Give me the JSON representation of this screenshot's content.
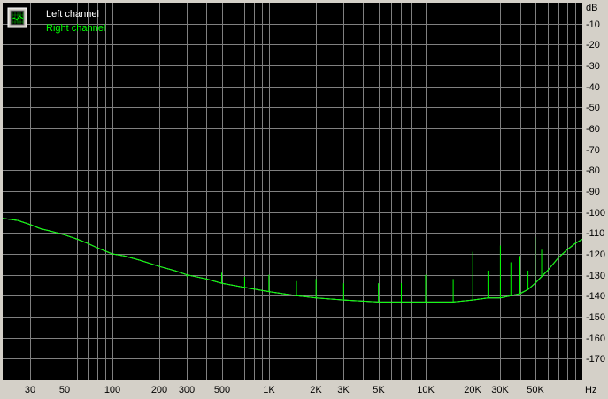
{
  "chart_data": {
    "type": "line",
    "xscale": "log",
    "xlim": [
      20,
      100000
    ],
    "ylim": [
      -180,
      0
    ],
    "grid": true,
    "legend_position": "top-left",
    "x_unit": "Hz",
    "y_unit": "dB",
    "x_tick_labels": [
      "30",
      "50",
      "100",
      "200",
      "300",
      "500",
      "1K",
      "2K",
      "3K",
      "5K",
      "10K",
      "20K",
      "30K",
      "50K"
    ],
    "x_tick_values": [
      30,
      50,
      100,
      200,
      300,
      500,
      1000,
      2000,
      3000,
      5000,
      10000,
      20000,
      30000,
      50000
    ],
    "y_tick_labels": [
      "-10",
      "-20",
      "-30",
      "-40",
      "-50",
      "-60",
      "-70",
      "-80",
      "-90",
      "-100",
      "-110",
      "-120",
      "-130",
      "-140",
      "-150",
      "-160",
      "-170"
    ],
    "y_tick_values": [
      -10,
      -20,
      -30,
      -40,
      -50,
      -60,
      -70,
      -80,
      -90,
      -100,
      -110,
      -120,
      -130,
      -140,
      -150,
      -160,
      -170
    ],
    "colors": {
      "background": "#000000",
      "grid": "#808080",
      "left": "#ffffff",
      "right": "#00ff00",
      "frame": "#d4d0c8"
    },
    "series": [
      {
        "name": "Left channel",
        "x": [
          20,
          25,
          30,
          35,
          40,
          50,
          60,
          70,
          80,
          100,
          120,
          150,
          200,
          250,
          300,
          400,
          500,
          700,
          1000,
          1500,
          2000,
          3000,
          5000,
          7000,
          10000,
          15000,
          20000,
          25000,
          30000,
          35000,
          40000,
          45000,
          50000,
          60000,
          70000,
          80000,
          90000,
          100000
        ],
        "y": [
          -103,
          -104,
          -106,
          -108,
          -109,
          -111,
          -113,
          -115,
          -117,
          -120,
          -121,
          -123,
          -126,
          -128,
          -130,
          -132,
          -134,
          -136,
          -138,
          -140,
          -141,
          -142,
          -143,
          -143,
          -143,
          -143,
          -142,
          -141,
          -141,
          -140,
          -139,
          -137,
          -134,
          -128,
          -122,
          -118,
          -115,
          -113
        ]
      },
      {
        "name": "Right channel",
        "x": [
          20,
          25,
          30,
          35,
          40,
          50,
          60,
          70,
          80,
          100,
          120,
          150,
          200,
          250,
          300,
          400,
          500,
          700,
          1000,
          1500,
          2000,
          3000,
          5000,
          7000,
          10000,
          15000,
          20000,
          25000,
          30000,
          35000,
          40000,
          45000,
          50000,
          60000,
          70000,
          80000,
          90000,
          100000
        ],
        "y": [
          -103,
          -104,
          -106,
          -108,
          -109,
          -111,
          -113,
          -115,
          -117,
          -120,
          -121,
          -123,
          -126,
          -128,
          -130,
          -132,
          -134,
          -136,
          -138,
          -140,
          -141,
          -142,
          -143,
          -143,
          -143,
          -143,
          -142,
          -141,
          -141,
          -140,
          -139,
          -137,
          -134,
          -128,
          -122,
          -118,
          -115,
          -113
        ]
      }
    ],
    "spurs_right": {
      "x": [
        300,
        500,
        700,
        1000,
        1500,
        2000,
        3000,
        5000,
        7000,
        10000,
        15000,
        20000,
        25000,
        30000,
        35000,
        40000,
        45000,
        50000,
        55000
      ],
      "y": [
        -131,
        -129,
        -131,
        -130,
        -133,
        -132,
        -134,
        -134,
        -134,
        -130,
        -132,
        -119,
        -128,
        -116,
        -124,
        -121,
        -128,
        -112,
        -118
      ]
    }
  },
  "legend": {
    "left_label": "Left channel",
    "right_label": "Right channel"
  }
}
